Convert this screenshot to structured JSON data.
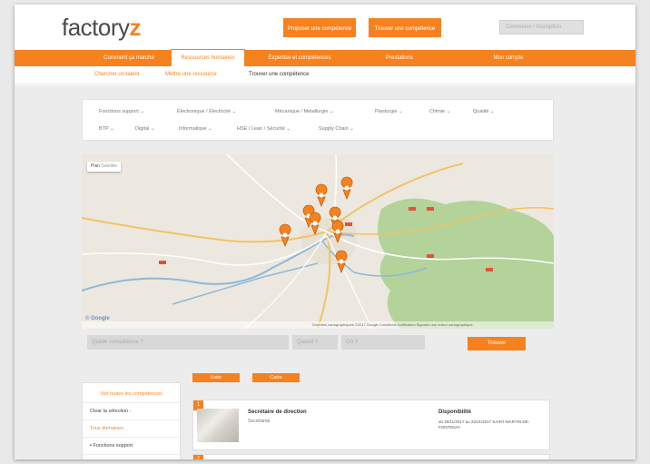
{
  "header": {
    "logo_text": "factory",
    "logo_accent": "z",
    "btn_propose": "Proposer une compétence",
    "btn_find": "Trouver une compétence",
    "login_placeholder": "Connexion / Inscription"
  },
  "nav": {
    "items": [
      {
        "label": "Comment ça marche"
      },
      {
        "label": "Ressources humaines"
      },
      {
        "label": "Expertise et compétences"
      },
      {
        "label": "Prestations"
      },
      {
        "label": "Mon compte"
      }
    ]
  },
  "subnav": {
    "items": [
      {
        "label": "Chercher un talent"
      },
      {
        "label": "Mettre une ressource"
      },
      {
        "label": "Trouver une compétence"
      }
    ]
  },
  "filters": {
    "row1": [
      "Fonctions support",
      "Électronique / Électricité",
      "Mécanique / Métallurgie",
      "Plasturgie",
      "Chimie",
      "Qualité"
    ],
    "row2": [
      "BTP",
      "Digital",
      "Informatique",
      "HSE / Lean / Sécurité",
      "Supply Chain"
    ]
  },
  "map": {
    "tab_plan": "Plan",
    "tab_sat": "Satellite",
    "attribution": "© Google",
    "footer_text": "Données cartographiques ©2017 Google   Conditions d'utilisation   Signaler une erreur cartographique"
  },
  "search": {
    "field1": "Quelle compétence ?",
    "field2": "Quand ?",
    "field3": "Où ?",
    "button": "Trouver"
  },
  "sidebar": {
    "link": "Voir toutes les compétences",
    "clear": "Clear la sélection :",
    "selection": "Tous domaines",
    "item": "Fonctions support"
  },
  "results": {
    "tab_list": "Liste",
    "tab_map": "Carte",
    "cards": [
      {
        "index": "1",
        "title": "Secrétaire de direction",
        "subtitle": "Secrétariat",
        "dispo_label": "Disponibilité",
        "dates": "du 20/11/2017 au 22/11/2017 SAINT-MARTIN-DE-FONTENAY"
      },
      {
        "index": "2"
      }
    ]
  },
  "colors": {
    "accent": "#f5821f",
    "text": "#333333",
    "background": "#ececec"
  }
}
